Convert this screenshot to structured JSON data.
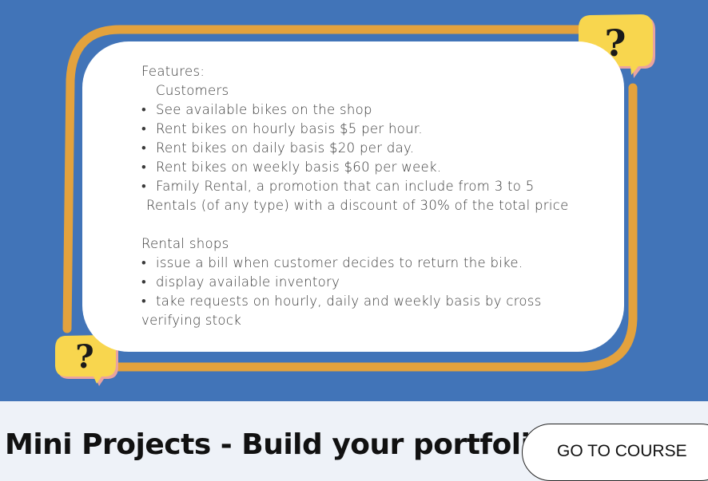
{
  "colors": {
    "banner_bg": "#4174b8",
    "frame_accent": "#e3a23d",
    "bubble_fill": "#f8d64e",
    "bubble_outline": "#e9a3a0",
    "card_bg": "#ffffff",
    "page_bg": "#eef2f8"
  },
  "bubbles": {
    "top_right": {
      "icon": "question-mark-bubble-icon",
      "glyph": "?"
    },
    "bottom_left": {
      "icon": "question-mark-bubble-icon",
      "glyph": "?"
    }
  },
  "card": {
    "heading": "Features:",
    "customers_label": "Customers",
    "customer_items": [
      "See available bikes on the shop",
      "Rent bikes on hourly basis $5 per hour.",
      "Rent bikes on daily basis $20 per day.",
      "Rent bikes on weekly basis $60 per week.",
      "Family Rental, a promotion that can include from 3 to 5"
    ],
    "customer_item_continuation": "Rentals (of any type) with a discount of 30% of the total price",
    "shops_label": "Rental shops",
    "shop_items": [
      "issue a bill when customer decides to return the bike.",
      "display available inventory",
      "take requests on hourly, daily and weekly basis by cross"
    ],
    "shop_item_continuation": "verifying stock"
  },
  "footer": {
    "title": "Mini Projects - Build your portfolio",
    "button_label": "GO TO COURSE"
  }
}
